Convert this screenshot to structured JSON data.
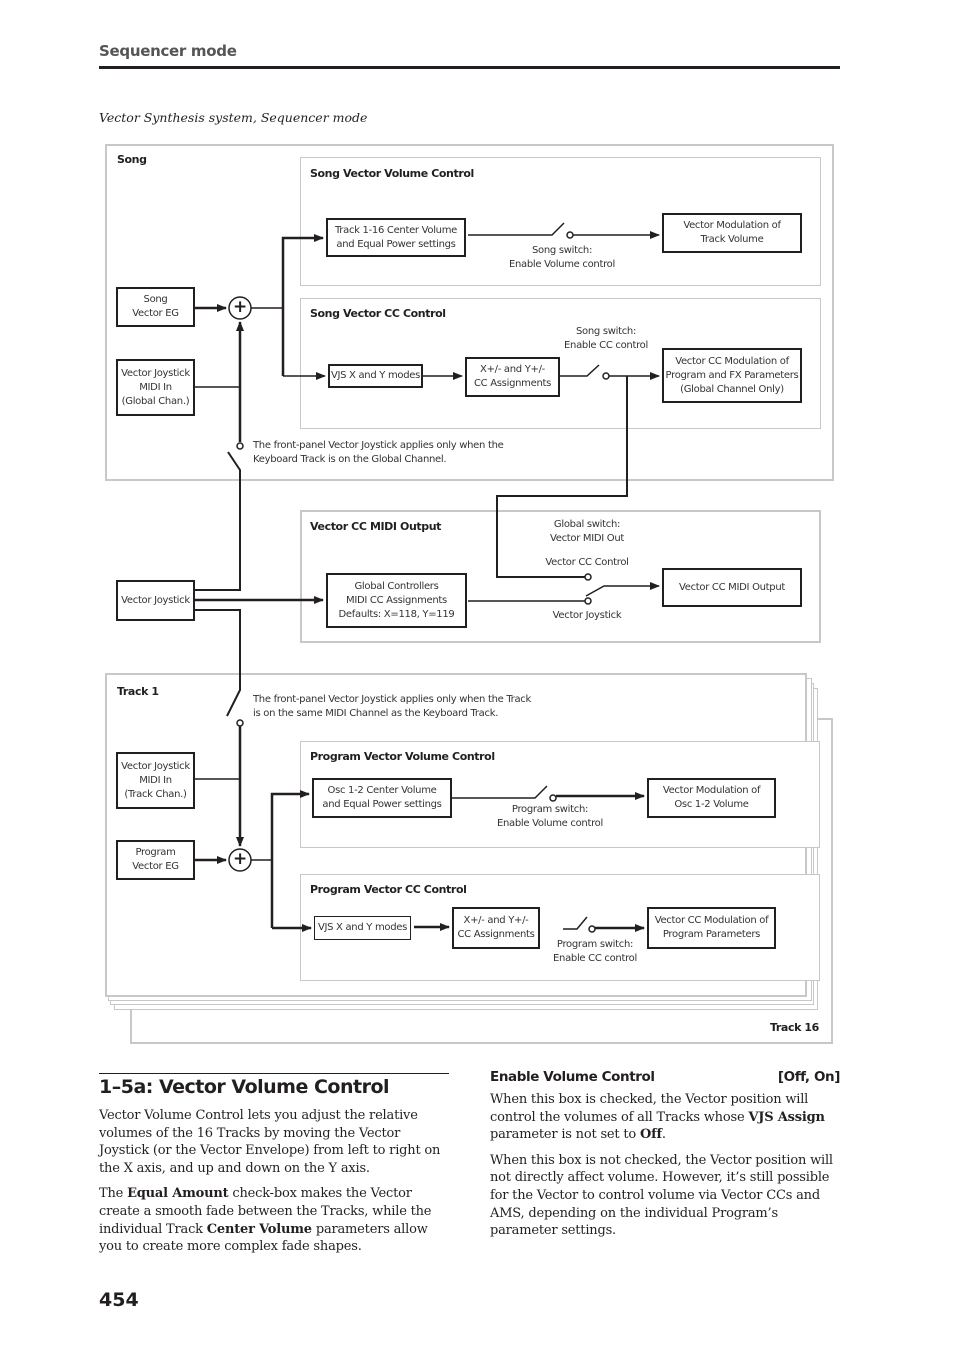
{
  "header": {
    "section": "Sequencer mode"
  },
  "figure_caption": "Vector Synthesis system, Sequencer mode",
  "diagram": {
    "song_panel": {
      "label": "Song",
      "song_vector_eg": "Song\nVector EG",
      "vjs_midi_in": "Vector Joystick\nMIDI In\n(Global Chan.)",
      "joystick_note": "The front-panel Vector Joystick applies only when the\nKeyboard Track is on the Global Channel.",
      "volume_control": {
        "label": "Song Vector Volume Control",
        "source": "Track 1-16 Center Volume\nand Equal Power settings",
        "switch": "Song switch:\nEnable Volume control",
        "target": "Vector Modulation of\nTrack Volume"
      },
      "cc_control": {
        "label": "Song Vector CC Control",
        "modes": "VJS X and Y modes",
        "assign": "X+/- and Y+/-\nCC Assignments",
        "switch": "Song switch:\nEnable CC control",
        "target": "Vector CC Modulation of\nProgram and FX Parameters\n(Global Channel Only)"
      }
    },
    "vector_joystick": "Vector Joystick",
    "midi_output": {
      "label": "Vector CC MIDI Output",
      "global_cc": "Global Controllers\nMIDI CC Assignments\nDefaults: X=118, Y=119",
      "switch": "Global switch:\nVector MIDI Out",
      "option_cc": "Vector CC Control",
      "option_joystick": "Vector Joystick",
      "target": "Vector CC MIDI Output"
    },
    "track_panel": {
      "label": "Track 1",
      "last_label": "Track 16",
      "joystick_note": "The front-panel Vector Joystick applies only when the Track\nis on the same MIDI Channel as the Keyboard Track.",
      "vjs_midi_in": "Vector Joystick\nMIDI In\n(Track Chan.)",
      "program_vector_eg": "Program\nVector EG",
      "volume_control": {
        "label": "Program Vector Volume Control",
        "source": "Osc 1-2 Center Volume\nand Equal Power settings",
        "switch": "Program switch:\nEnable Volume control",
        "target": "Vector Modulation of\nOsc 1-2 Volume"
      },
      "cc_control": {
        "label": "Program Vector CC Control",
        "modes": "VJS X and Y modes",
        "assign": "X+/- and Y+/-\nCC Assignments",
        "switch": "Program switch:\nEnable CC control",
        "target": "Vector CC Modulation of\nProgram Parameters"
      }
    },
    "sum_symbol": "+"
  },
  "section": {
    "title": "1–5a: Vector Volume Control",
    "p1": "Vector Volume Control lets you adjust the relative volumes of the 16 Tracks by moving the Vector Joystick (or the Vector Envelope) from left to right on the X axis, and up and down on the Y axis.",
    "p2_a": "The ",
    "p2_b": "Equal Amount",
    "p2_c": " check-box makes the Vector create a smooth fade between the Tracks, while the individual Track ",
    "p2_d": "Center Volume",
    "p2_e": " parameters allow you to create more complex fade shapes."
  },
  "parameter": {
    "name": "Enable Volume Control",
    "range": "[Off, On]",
    "p1_a": "When this box is checked, the Vector position will control the volumes of all Tracks whose ",
    "p1_b": "VJS Assign",
    "p1_c": " parameter is not set to ",
    "p1_d": "Off",
    "p1_e": ".",
    "p2": "When this box is not checked, the Vector position will not directly affect volume. However, it’s still possible for the Vector to control volume via Vector CCs and AMS, depending on the individual Program’s parameter settings."
  },
  "page_number": "454"
}
